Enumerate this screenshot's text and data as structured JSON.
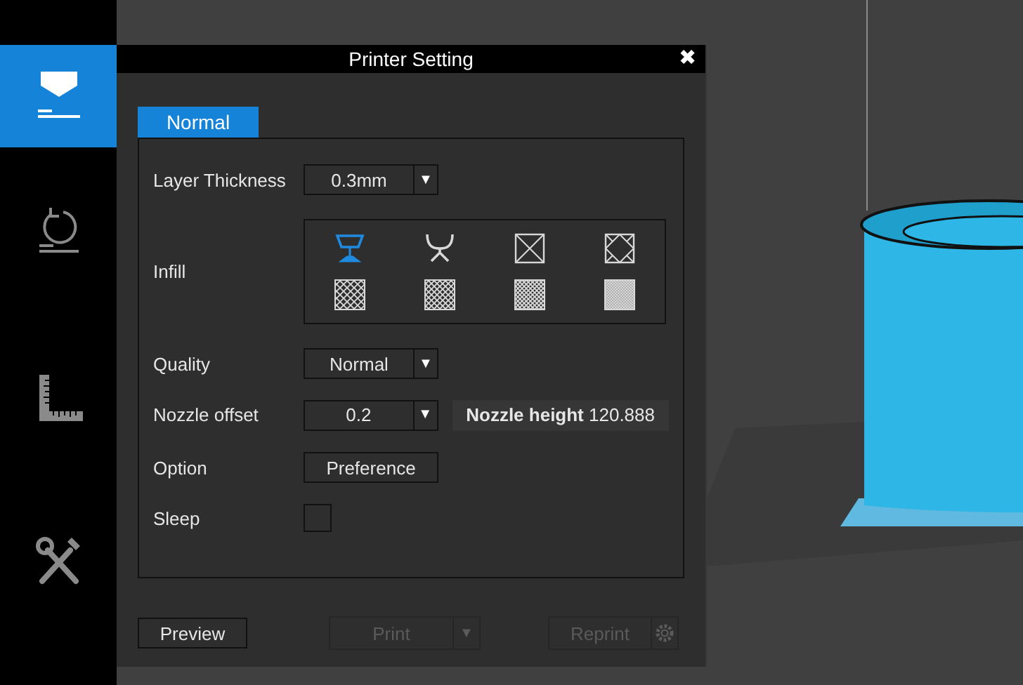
{
  "sidebar": {
    "items": [
      {
        "kind": "printer",
        "selected": true
      },
      {
        "kind": "undo",
        "selected": false
      },
      {
        "kind": "ruler",
        "selected": false
      },
      {
        "kind": "tools",
        "selected": false
      }
    ]
  },
  "dialog": {
    "title": "Printer Setting",
    "close": "✖",
    "tabs": [
      {
        "label": "Normal",
        "selected": true
      }
    ],
    "layer_thickness": {
      "label": "Layer Thickness",
      "value": "0.3mm",
      "arrow": "▼"
    },
    "infill": {
      "label": "Infill",
      "options": [
        {
          "kind": "cup",
          "selected": true
        },
        {
          "kind": "fork",
          "selected": false
        },
        {
          "kind": "cross",
          "selected": false
        },
        {
          "kind": "diamond",
          "selected": false
        },
        {
          "kind": "sparse",
          "selected": false
        },
        {
          "kind": "medium",
          "selected": false
        },
        {
          "kind": "dense",
          "selected": false
        },
        {
          "kind": "fine",
          "selected": false
        }
      ]
    },
    "quality": {
      "label": "Quality",
      "value": "Normal",
      "arrow": "▼"
    },
    "nozzle_offset": {
      "label": "Nozzle offset",
      "value": "0.2",
      "arrow": "▼",
      "height": "**Nozzle height** 120.888"
    },
    "option": {
      "label": "Option",
      "button": "Preference"
    },
    "sleep": {
      "label": "Sleep",
      "checked": false
    },
    "buttons": {
      "preview": {
        "label": "Preview",
        "disabled": false
      },
      "print": {
        "label": "Print",
        "arrow": "▼",
        "disabled": true
      },
      "reprint": {
        "label": "Reprint",
        "disabled": true
      }
    }
  }
}
